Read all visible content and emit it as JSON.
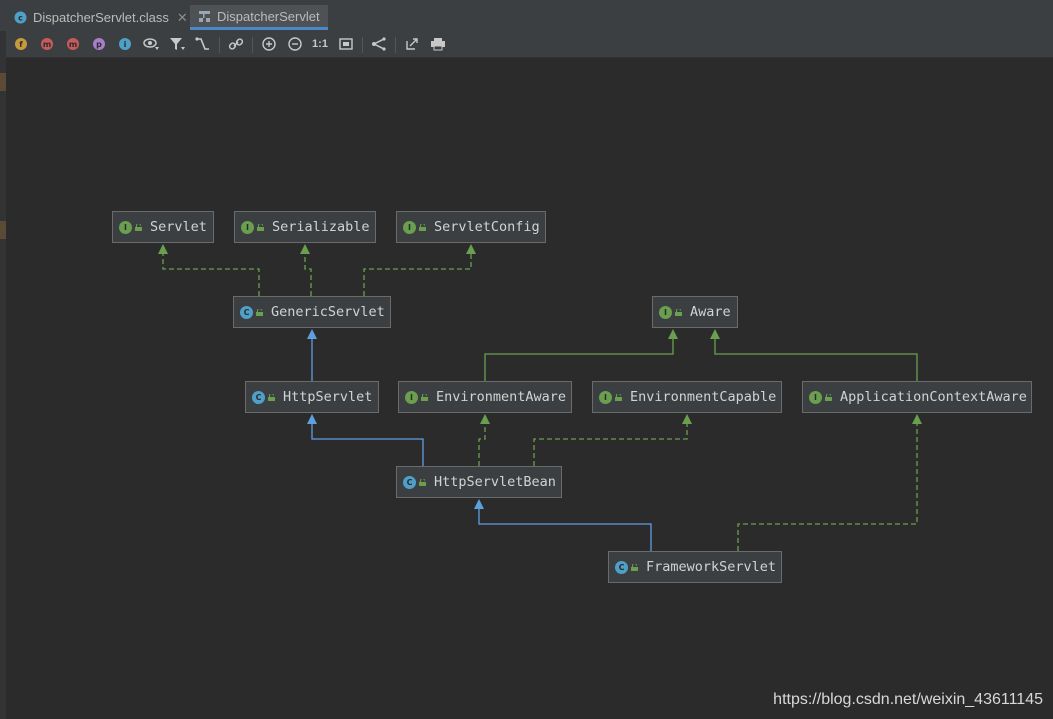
{
  "tabs": [
    {
      "label": "DispatcherServlet.class",
      "active": false
    },
    {
      "label": "DispatcherServlet",
      "active": true
    }
  ],
  "toolbar": {
    "badges": [
      "f",
      "m",
      "m",
      "p",
      "i"
    ],
    "zoom_actual_label": "1:1"
  },
  "diagram": {
    "nodes": [
      {
        "id": "Servlet",
        "name": "Servlet",
        "kind": "interface"
      },
      {
        "id": "Serializable",
        "name": "Serializable",
        "kind": "interface"
      },
      {
        "id": "ServletConfig",
        "name": "ServletConfig",
        "kind": "interface"
      },
      {
        "id": "GenericServlet",
        "name": "GenericServlet",
        "kind": "abstract-class"
      },
      {
        "id": "Aware",
        "name": "Aware",
        "kind": "interface"
      },
      {
        "id": "HttpServlet",
        "name": "HttpServlet",
        "kind": "abstract-class"
      },
      {
        "id": "EnvironmentAware",
        "name": "EnvironmentAware",
        "kind": "interface"
      },
      {
        "id": "EnvironmentCapable",
        "name": "EnvironmentCapable",
        "kind": "interface"
      },
      {
        "id": "ApplicationContextAware",
        "name": "ApplicationContextAware",
        "kind": "interface"
      },
      {
        "id": "HttpServletBean",
        "name": "HttpServletBean",
        "kind": "abstract-class"
      },
      {
        "id": "FrameworkServlet",
        "name": "FrameworkServlet",
        "kind": "abstract-class"
      }
    ],
    "edges": [
      {
        "from": "GenericServlet",
        "to": "Servlet",
        "type": "implements"
      },
      {
        "from": "GenericServlet",
        "to": "Serializable",
        "type": "implements"
      },
      {
        "from": "GenericServlet",
        "to": "ServletConfig",
        "type": "implements"
      },
      {
        "from": "HttpServlet",
        "to": "GenericServlet",
        "type": "extends"
      },
      {
        "from": "EnvironmentAware",
        "to": "Aware",
        "type": "extends-interface"
      },
      {
        "from": "ApplicationContextAware",
        "to": "Aware",
        "type": "extends-interface"
      },
      {
        "from": "HttpServletBean",
        "to": "HttpServlet",
        "type": "extends"
      },
      {
        "from": "HttpServletBean",
        "to": "EnvironmentAware",
        "type": "implements"
      },
      {
        "from": "HttpServletBean",
        "to": "EnvironmentCapable",
        "type": "implements"
      },
      {
        "from": "FrameworkServlet",
        "to": "HttpServletBean",
        "type": "extends"
      },
      {
        "from": "FrameworkServlet",
        "to": "ApplicationContextAware",
        "type": "implements"
      }
    ]
  },
  "colors": {
    "implements": "#6a9f4f",
    "extends": "#5e9fe0",
    "interface_badge": "#6a9f4f",
    "class_badge": "#4fa0c8"
  },
  "watermark": "https://blog.csdn.net/weixin_43611145"
}
